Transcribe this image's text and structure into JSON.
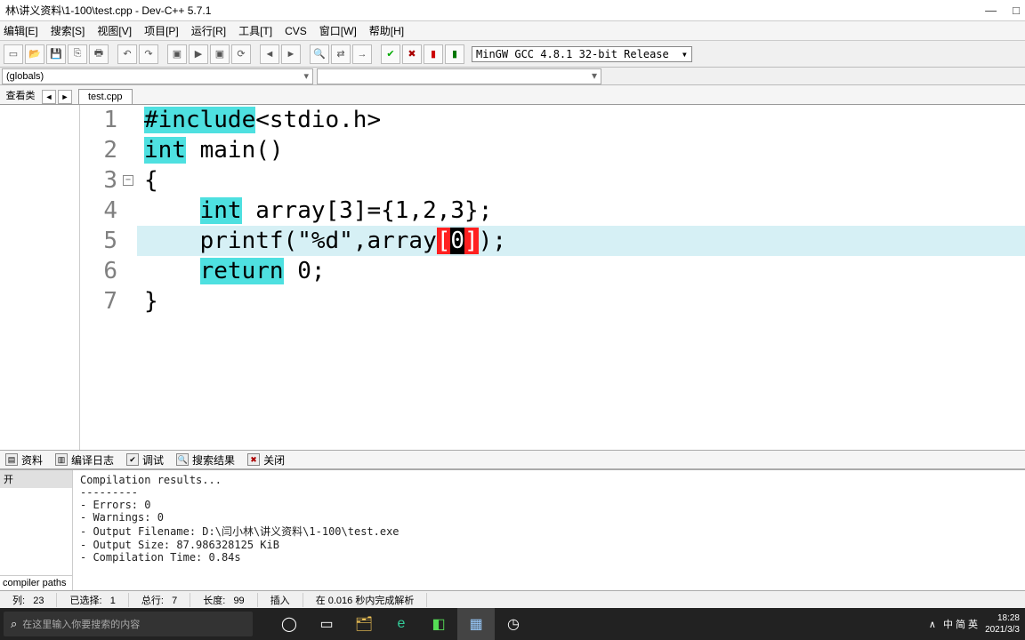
{
  "title": "林\\讲义资料\\1-100\\test.cpp - Dev-C++ 5.7.1",
  "menu": [
    "编辑[E]",
    "搜索[S]",
    "视图[V]",
    "项目[P]",
    "运行[R]",
    "工具[T]",
    "CVS",
    "窗口[W]",
    "帮助[H]"
  ],
  "compiler": "MinGW GCC 4.8.1 32-bit Release",
  "scope_combo": "(globals)",
  "side_tab": "查看类",
  "file_tab": "test.cpp",
  "lines": [
    "1",
    "2",
    "3",
    "4",
    "5",
    "6",
    "7"
  ],
  "code": {
    "l1": {
      "kw": "#include",
      "rest": "<stdio.h>"
    },
    "l2": {
      "kw": "int",
      "rest": " main()"
    },
    "l3": "{",
    "l4": {
      "pre": "    ",
      "kw": "int",
      "rest": " array[3]={1,2,3};"
    },
    "l5": {
      "pre": "    printf(",
      "str": "\"%d\"",
      "mid": ",array",
      "b1": "[",
      "idx": "0",
      "b2": "]",
      "end": ");"
    },
    "l6": {
      "pre": "    ",
      "kw": "return",
      "rest": " 0;"
    },
    "l7": "}"
  },
  "bottom_tabs": [
    "资料",
    "编译日志",
    "调试",
    "搜索结果",
    "关闭"
  ],
  "log_side_top": "开",
  "log_side_bottom": "compiler paths",
  "log_output": "Compilation results...\n---------\n- Errors: 0\n- Warnings: 0\n- Output Filename: D:\\闫小林\\讲义资料\\1-100\\test.exe\n- Output Size: 87.986328125 KiB\n- Compilation Time: 0.84s",
  "status": {
    "col_lbl": "列:",
    "col": "23",
    "sel_lbl": "已选择:",
    "sel": "1",
    "tot_lbl": "总行:",
    "tot": "7",
    "len_lbl": "长度:",
    "len": "99",
    "mode": "插入",
    "parse": "在 0.016 秒内完成解析"
  },
  "taskbar": {
    "search_ph": "在这里输入你要搜索的内容",
    "tray_items": [
      "∧",
      "中 简 英"
    ],
    "time": "18:28",
    "date": "2021/3/3"
  }
}
